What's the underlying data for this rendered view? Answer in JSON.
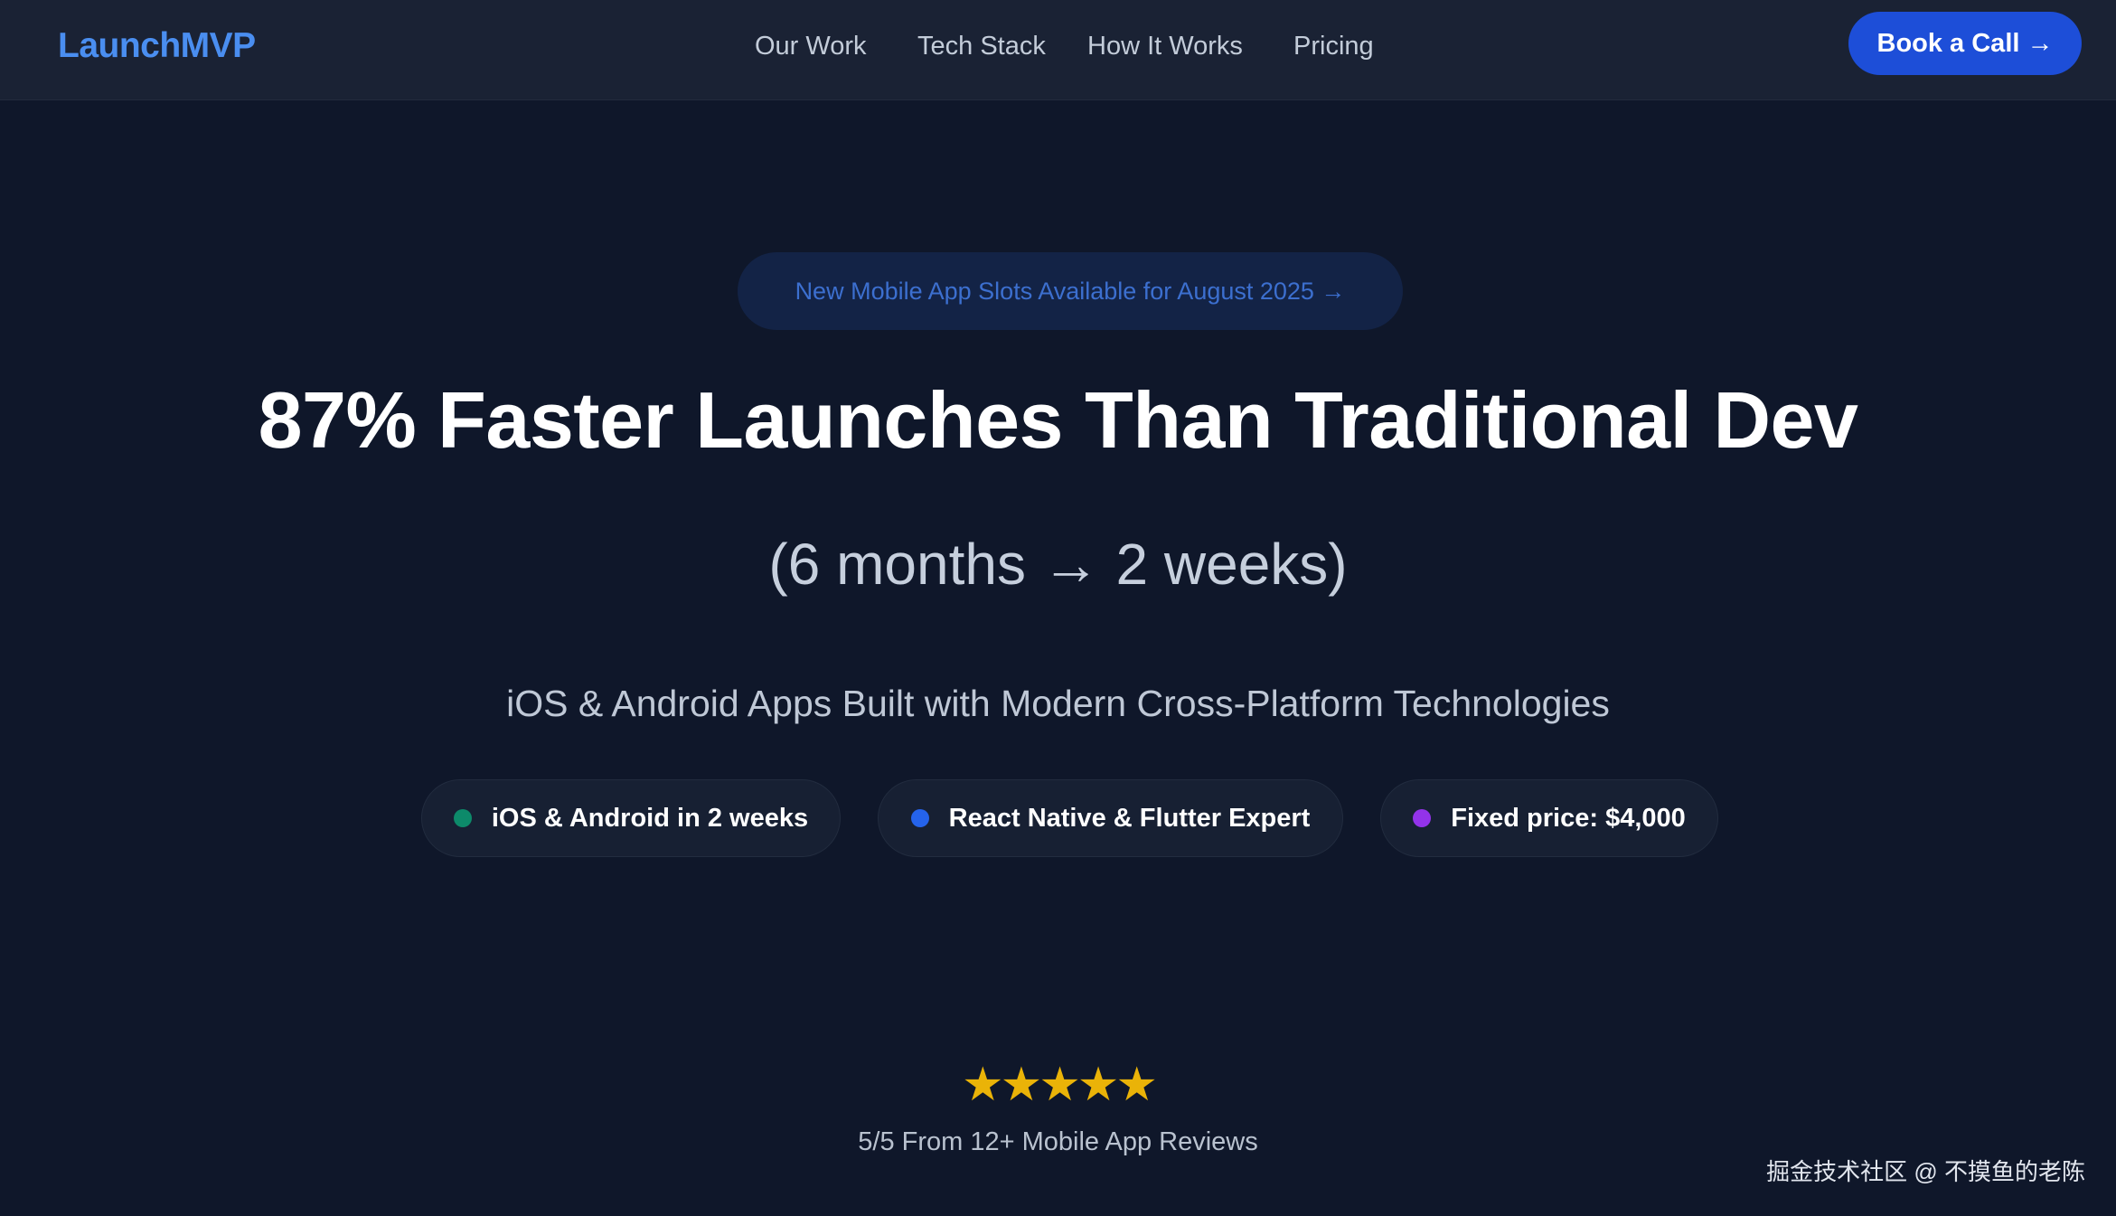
{
  "header": {
    "logo": "LaunchMVP",
    "nav": [
      "Our Work",
      "Tech Stack",
      "How It Works",
      "Pricing"
    ],
    "cta_label": "Book a Call →"
  },
  "hero": {
    "announcement": "New Mobile App Slots Available for August 2025 →",
    "headline": "87% Faster Launches Than Traditional Dev",
    "subheadline": "(6 months → 2 weeks)",
    "tagline": "iOS & Android Apps Built with Modern Cross-Platform Technologies",
    "features": [
      {
        "label": "iOS & Android in 2 weeks",
        "dot_color": "#0d8a6a"
      },
      {
        "label": "React Native & Flutter Expert",
        "dot_color": "#2563eb"
      },
      {
        "label": "Fixed price: $4,000",
        "dot_color": "#9333ea"
      }
    ]
  },
  "rating": {
    "stars": "★★★★★",
    "star_count": 5,
    "star_color": "#eab308",
    "summary": "5/5 From 12+ Mobile App Reviews"
  },
  "watermark": "掘金技术社区 @ 不摸鱼的老陈",
  "colors": {
    "background": "#0f172a",
    "header_bg": "#1a2234",
    "accent": "#1d4ed8",
    "logo": "#4a8ef0"
  }
}
